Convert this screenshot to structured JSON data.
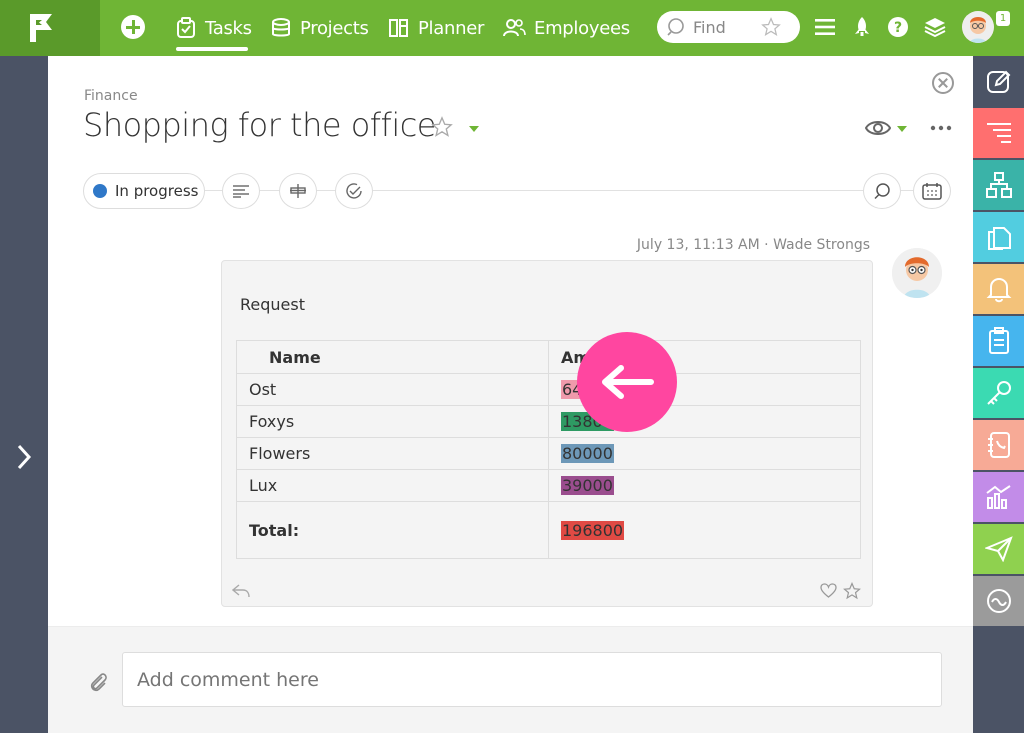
{
  "topbar": {
    "nav": [
      {
        "label": "Tasks",
        "icon": "tasks-icon"
      },
      {
        "label": "Projects",
        "icon": "projects-icon"
      },
      {
        "label": "Planner",
        "icon": "planner-icon"
      },
      {
        "label": "Employees",
        "icon": "employees-icon"
      }
    ],
    "search_placeholder": "Find",
    "notification_count": "1",
    "accent_color": "#6fb535"
  },
  "task": {
    "breadcrumb": "Finance",
    "title": "Shopping for the office",
    "status": "In progress",
    "status_color": "#2f78c8"
  },
  "message": {
    "timestamp": "July 13, 11:13 AM",
    "separator": "·",
    "author": "Wade Strongs",
    "text": "Request",
    "table": {
      "headers": [
        "Name",
        "Amount"
      ],
      "rows": [
        {
          "name": "Ost",
          "amount": "64500",
          "color": "#ef9aab"
        },
        {
          "name": "Foxys",
          "amount": "13800",
          "color": "#2e9a63"
        },
        {
          "name": "Flowers",
          "amount": "80000",
          "color": "#6d98b8"
        },
        {
          "name": "Lux",
          "amount": "39000",
          "color": "#9a4d8e"
        }
      ],
      "total_label": "Total:",
      "total_amount": "196800",
      "total_color": "#e04a44"
    }
  },
  "comment": {
    "placeholder": "Add comment here"
  },
  "right_rail": [
    {
      "icon": "edit-icon",
      "color": "#4b5365"
    },
    {
      "icon": "list-icon",
      "color": "#ff6f6f"
    },
    {
      "icon": "org-chart-icon",
      "color": "#3ab3a8"
    },
    {
      "icon": "documents-icon",
      "color": "#52cde0"
    },
    {
      "icon": "bell-icon",
      "color": "#f3c27a"
    },
    {
      "icon": "clipboard-icon",
      "color": "#46b5ee"
    },
    {
      "icon": "key-icon",
      "color": "#3bdab2"
    },
    {
      "icon": "phone-book-icon",
      "color": "#f7aa96"
    },
    {
      "icon": "analytics-icon",
      "color": "#c28ce8"
    },
    {
      "icon": "send-icon",
      "color": "#8fd14f"
    },
    {
      "icon": "wave-icon",
      "color": "#9b9b9b"
    }
  ]
}
